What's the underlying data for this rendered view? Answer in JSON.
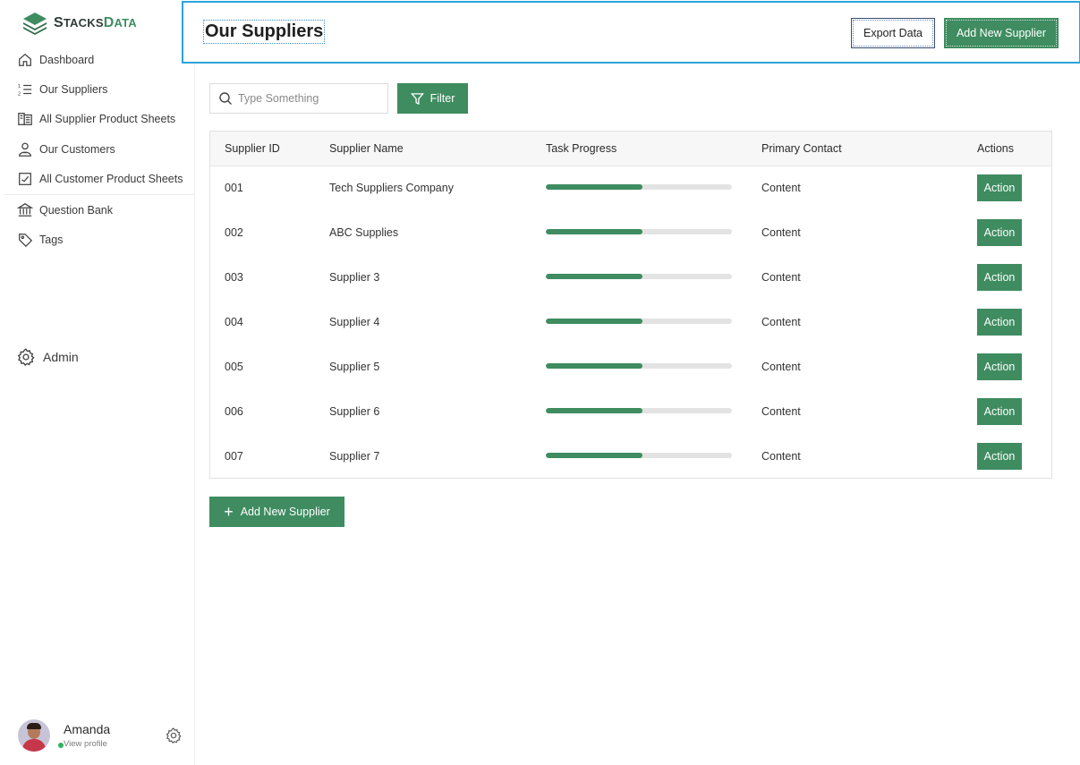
{
  "brand": {
    "logo_text_main": "S",
    "logo_text_rest": "TACKS",
    "logo_text_second": "D",
    "logo_text_second_rest": "ATA",
    "logo_icon": "stacked-layers-icon",
    "accent_color": "#3e8c60"
  },
  "sidebar": {
    "items": [
      {
        "label": "Dashboard",
        "icon": "home-icon"
      },
      {
        "label": "Our Suppliers",
        "icon": "numbered-list-icon"
      },
      {
        "label": "All Supplier Product Sheets",
        "icon": "product-sheet-icon"
      },
      {
        "label": "Our Customers",
        "icon": "customer-icon"
      },
      {
        "label": "All Customer Product Sheets",
        "icon": "checklist-icon"
      },
      {
        "label": "Question Bank",
        "icon": "bank-icon"
      },
      {
        "label": "Tags",
        "icon": "tag-icon"
      }
    ],
    "admin_label": "Admin",
    "admin_icon": "gear-icon"
  },
  "profile": {
    "name": "Amanda",
    "subtitle": "View profile",
    "status_color": "#2fb35a"
  },
  "header": {
    "title": "Our Suppliers",
    "export_label": "Export Data",
    "add_label": "Add New Supplier"
  },
  "toolbar": {
    "search_placeholder": "Type Something",
    "filter_label": "Filter"
  },
  "table": {
    "columns": [
      "Supplier ID",
      "Supplier Name",
      "Task Progress",
      "Primary Contact",
      "Actions"
    ],
    "rows": [
      {
        "id": "001",
        "name": "Tech Suppliers Company",
        "progress": 0.52,
        "contact": "Content",
        "action": "Action"
      },
      {
        "id": "002",
        "name": "ABC Supplies",
        "progress": 0.52,
        "contact": "Content",
        "action": "Action"
      },
      {
        "id": "003",
        "name": "Supplier 3",
        "progress": 0.52,
        "contact": "Content",
        "action": "Action"
      },
      {
        "id": "004",
        "name": "Supplier 4",
        "progress": 0.52,
        "contact": "Content",
        "action": "Action"
      },
      {
        "id": "005",
        "name": "Supplier 5",
        "progress": 0.52,
        "contact": "Content",
        "action": "Action"
      },
      {
        "id": "006",
        "name": "Supplier 6",
        "progress": 0.52,
        "contact": "Content",
        "action": "Action"
      },
      {
        "id": "007",
        "name": "Supplier 7",
        "progress": 0.52,
        "contact": "Content",
        "action": "Action"
      }
    ]
  },
  "footer_actions": {
    "add_label": "Add New Supplier"
  }
}
